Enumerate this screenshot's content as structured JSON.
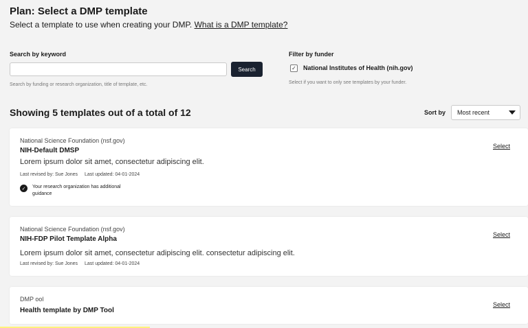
{
  "header": {
    "title": "Plan: Select a DMP template",
    "subtitle": "Select a template to use when creating your DMP.",
    "help_link": "What is a DMP template?"
  },
  "search": {
    "label": "Search by keyword",
    "value": "",
    "placeholder": "",
    "button_label": "Search",
    "help": "Search by funding or research organization, title of template, etc."
  },
  "funder_filter": {
    "label": "Filter by funder",
    "option_label": "National Institutes of Health (nih.gov)",
    "checked": true,
    "help": "Select if you want to only see templates by your funder."
  },
  "results": {
    "title": "Showing 5 templates out of a total of 12",
    "sort_label": "Sort by",
    "sort_value": "Most recent"
  },
  "templates": [
    {
      "funder": "National Science Foundation (nsf.gov)",
      "title": "NIH-Default DMSP",
      "description": "Lorem ipsum dolor sit amet, consectetur adipiscing elit.",
      "revised_by": "Last revised by: Sue Jones",
      "updated": "Last updated: 04-01-2024",
      "guidance": "Your research organization has additional guidance",
      "select_label": "Select"
    },
    {
      "funder": "National Science Foundation (nsf.gov)",
      "title": "NIH-FDP Pilot Template Alpha",
      "description": "Lorem ipsum dolor sit amet, consectetur adipiscing elit. consectetur adipiscing elit.",
      "revised_by": "Last revised by: Sue Jones",
      "updated": "Last updated: 04-01-2024",
      "select_label": "Select"
    },
    {
      "funder": "DMP ool",
      "title": "Health template by DMP Tool",
      "select_label": "Select"
    }
  ],
  "icons": {
    "checkbox": "checkmark-icon",
    "guidance": "check-circle-icon",
    "sort": "caret-down-icon"
  }
}
